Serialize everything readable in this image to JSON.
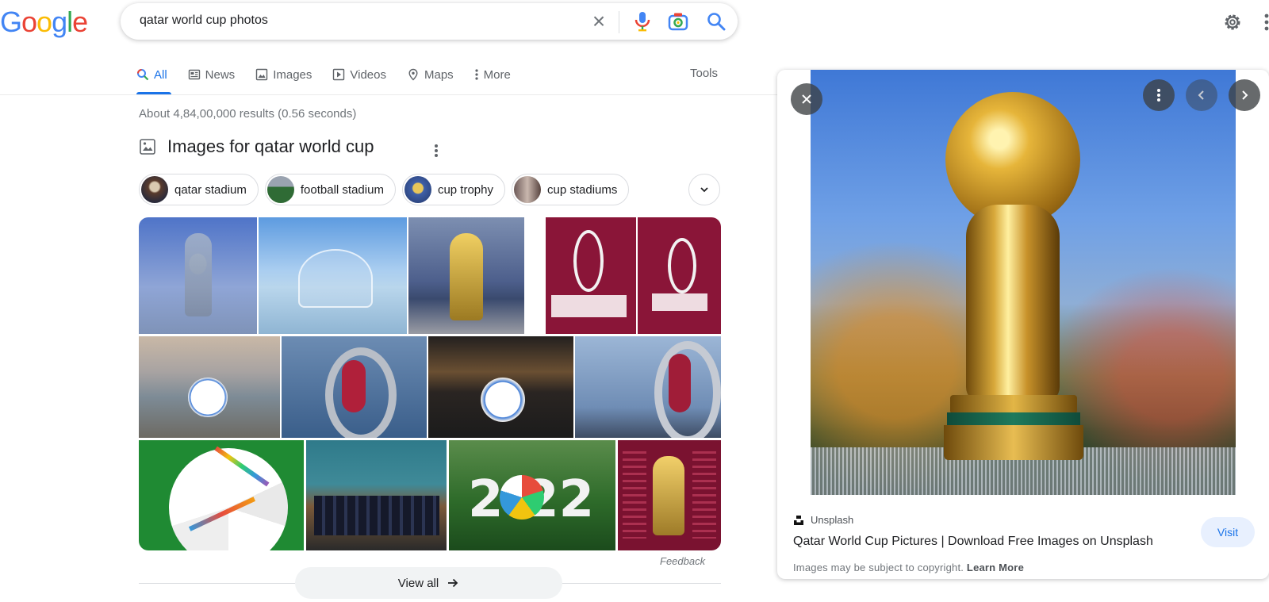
{
  "logo": [
    "G",
    "o",
    "o",
    "g",
    "l",
    "e"
  ],
  "search": {
    "query": "qatar world cup photos"
  },
  "tabs": [
    {
      "label": "All",
      "icon": "search-icon"
    },
    {
      "label": "News",
      "icon": "news-icon"
    },
    {
      "label": "Images",
      "icon": "image-icon"
    },
    {
      "label": "Videos",
      "icon": "video-icon"
    },
    {
      "label": "Maps",
      "icon": "map-pin-icon"
    },
    {
      "label": "More",
      "icon": "more-vert-icon"
    }
  ],
  "tools_label": "Tools",
  "results_count": "About 4,84,00,000 results (0.56 seconds)",
  "images_section": {
    "title": "Images for qatar world cup",
    "chips": [
      "qatar stadium",
      "football stadium",
      "cup trophy",
      "cup stadiums"
    ]
  },
  "feedback_label": "Feedback",
  "view_all_label": "View all",
  "side_panel": {
    "source": "Unsplash",
    "title": "Qatar World Cup Pictures | Download Free Images on Unsplash",
    "visit_label": "Visit",
    "copyright_text": "Images may be subject to copyright.",
    "learn_more": "Learn More"
  },
  "colors": {
    "accent": "#1a73e8",
    "google_blue": "#4285f4",
    "google_red": "#ea4335",
    "google_yellow": "#fbbc05",
    "google_green": "#34a853"
  }
}
